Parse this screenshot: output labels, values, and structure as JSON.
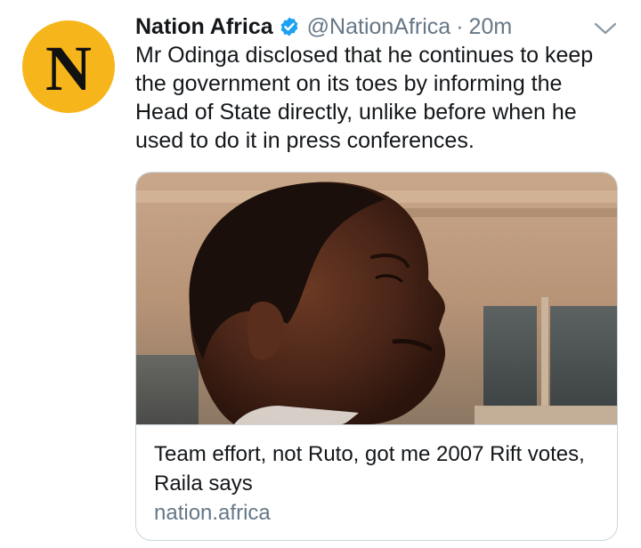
{
  "tweet": {
    "avatar_letter": "N",
    "avatar_color": "#f6b51a",
    "display_name": "Nation Africa",
    "verified_icon": "verified-badge-icon",
    "handle": "@NationAfrica",
    "separator": "·",
    "time": "20m",
    "menu_icon": "chevron-down-icon",
    "text": "Mr Odinga disclosed that he continues to keep the government on its toes by informing the Head of State directly, unlike before when he used to do it in press conferences."
  },
  "card": {
    "image": "photo of a man in profile looking up",
    "title": "Team effort, not Ruto, got me 2007 Rift votes, Raila says",
    "domain": "nation.africa"
  },
  "colors": {
    "verified": "#1da1f2",
    "secondary_text": "#657786",
    "border": "#ccd6dd",
    "primary_text": "#14171a"
  }
}
